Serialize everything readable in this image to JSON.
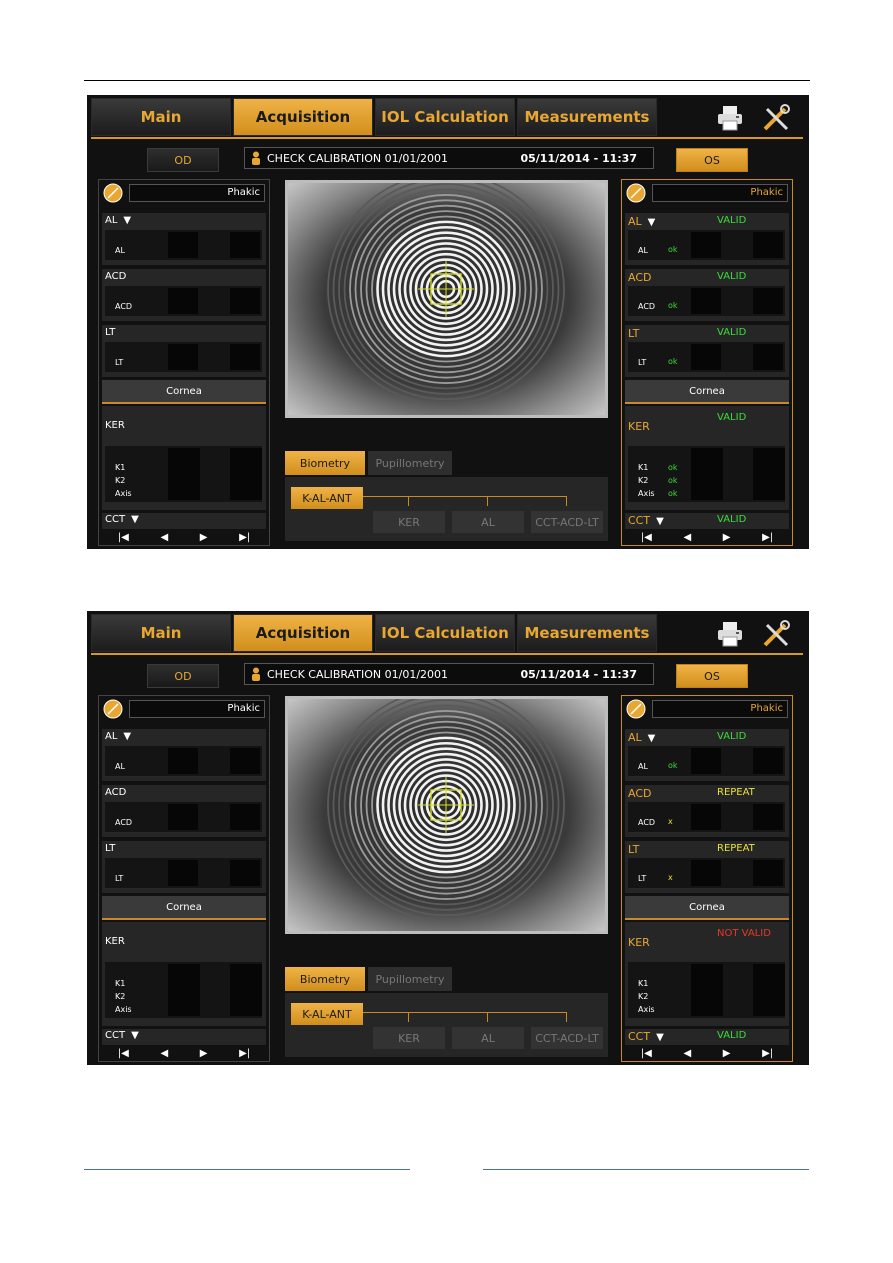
{
  "tabs": [
    "Main",
    "Acquisition",
    "IOL Calculation",
    "Measurements"
  ],
  "screens": [
    {
      "od": "OD",
      "os": "OS",
      "status_text": "CHECK CALIBRATION 01/01/2001",
      "datetime": "05/11/2014 - 11:37",
      "lens_left": "Phakic",
      "lens_right": "Phakic",
      "left": {
        "al": "AL",
        "acd": "ACD",
        "lt": "LT",
        "al_sub": "AL",
        "acd_sub": "ACD",
        "lt_sub": "LT",
        "cornea": "Cornea",
        "ker": "KER",
        "k1": "K1",
        "k2": "K2",
        "axis": "Axis",
        "cct": "CCT"
      },
      "right": {
        "al": "AL",
        "al_status": "VALID",
        "al_sub": "AL",
        "al_ok": "ok",
        "acd": "ACD",
        "acd_status": "VALID",
        "acd_sub": "ACD",
        "acd_ok": "ok",
        "lt": "LT",
        "lt_status": "VALID",
        "lt_sub": "LT",
        "lt_ok": "ok",
        "cornea": "Cornea",
        "ker": "KER",
        "ker_status": "VALID",
        "k1": "K1",
        "k2": "K2",
        "axis": "Axis",
        "k1_ok": "ok",
        "k2_ok": "ok",
        "axis_ok": "ok",
        "cct": "CCT",
        "cct_status": "VALID"
      },
      "biometry": "Biometry",
      "pupillometry": "Pupillometry",
      "kalant": "K-AL-ANT",
      "ker_btn": "KER",
      "al_btn": "AL",
      "cct_btn": "CCT-ACD-LT"
    },
    {
      "od": "OD",
      "os": "OS",
      "status_text": "CHECK CALIBRATION 01/01/2001",
      "datetime": "05/11/2014 - 11:37",
      "lens_left": "Phakic",
      "lens_right": "Phakic",
      "left": {
        "al": "AL",
        "acd": "ACD",
        "lt": "LT",
        "al_sub": "AL",
        "acd_sub": "ACD",
        "lt_sub": "LT",
        "cornea": "Cornea",
        "ker": "KER",
        "k1": "K1",
        "k2": "K2",
        "axis": "Axis",
        "cct": "CCT"
      },
      "right": {
        "al": "AL",
        "al_status": "VALID",
        "al_sub": "AL",
        "al_ok": "ok",
        "acd": "ACD",
        "acd_status": "REPEAT",
        "acd_sub": "ACD",
        "acd_ok": "x",
        "lt": "LT",
        "lt_status": "REPEAT",
        "lt_sub": "LT",
        "lt_ok": "x",
        "cornea": "Cornea",
        "ker": "KER",
        "ker_status": "NOT VALID",
        "k1": "K1",
        "k2": "K2",
        "axis": "Axis",
        "k1_ok": "",
        "k2_ok": "",
        "axis_ok": "",
        "cct": "CCT",
        "cct_status": "VALID"
      },
      "biometry": "Biometry",
      "pupillometry": "Pupillometry",
      "kalant": "K-AL-ANT",
      "ker_btn": "KER",
      "al_btn": "AL",
      "cct_btn": "CCT-ACD-LT"
    }
  ],
  "nav_glyphs": [
    "|◀",
    "◀",
    "▶",
    "▶|"
  ],
  "colors": {
    "accent": "#e8a733",
    "valid": "#3bdc3b",
    "repeat": "#e8e03a",
    "not_valid": "#e23a2a"
  }
}
